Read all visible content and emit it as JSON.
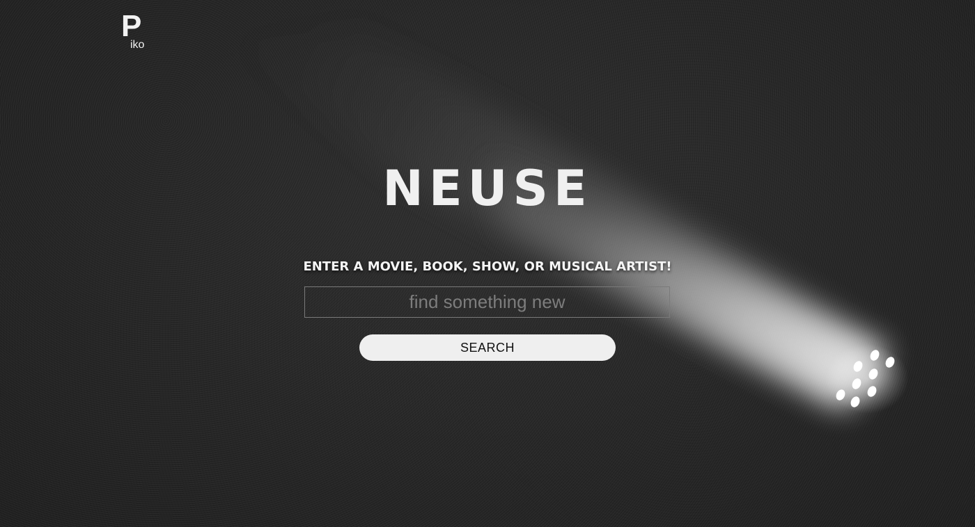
{
  "brand": {
    "logo_mark": "P",
    "logo_sub": "iko"
  },
  "hero": {
    "title": "NEUSE",
    "prompt": "ENTER A MOVIE, BOOK, SHOW, OR MUSICAL ARTIST!"
  },
  "search": {
    "placeholder": "find something new",
    "value": "",
    "button_label": "SEARCH"
  },
  "background": {
    "image": "spotlight-beam",
    "colors": {
      "base": "#262626",
      "beam": "#dcdcdc",
      "text": "#f0f0f0",
      "button_bg": "#efefef"
    }
  }
}
